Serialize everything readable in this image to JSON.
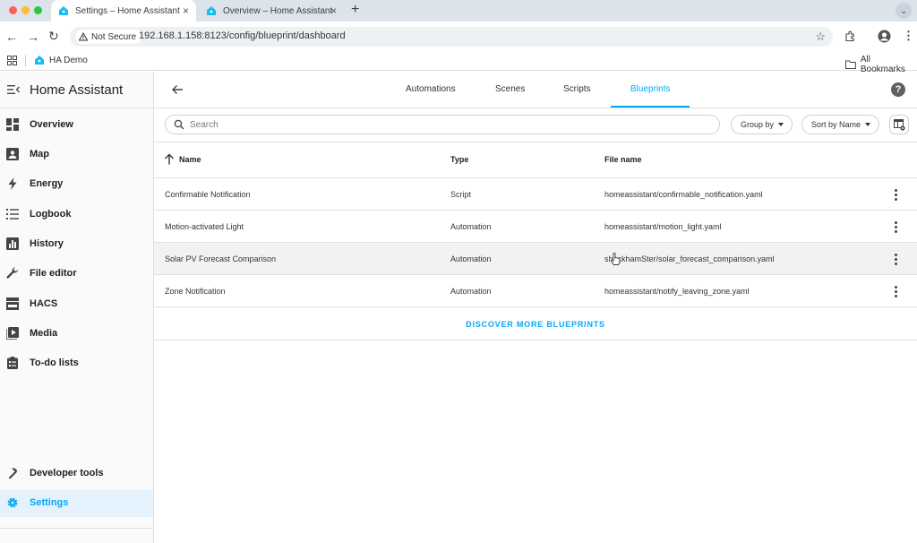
{
  "browser": {
    "tabs": [
      {
        "title": "Settings – Home Assistant",
        "active": true
      },
      {
        "title": "Overview – Home Assistant",
        "active": false
      }
    ],
    "new_tab": "+",
    "security_label": "Not Secure",
    "url": "192.168.1.158:8123/config/blueprint/dashboard",
    "bookmarks": {
      "item": "HA Demo",
      "all": "All Bookmarks"
    }
  },
  "sidebar": {
    "title": "Home Assistant",
    "items": [
      {
        "label": "Overview",
        "icon": "dashboard-icon"
      },
      {
        "label": "Map",
        "icon": "map-icon"
      },
      {
        "label": "Energy",
        "icon": "lightning-icon"
      },
      {
        "label": "Logbook",
        "icon": "list-icon"
      },
      {
        "label": "History",
        "icon": "chart-icon"
      },
      {
        "label": "File editor",
        "icon": "wrench-icon"
      },
      {
        "label": "HACS",
        "icon": "hacs-icon"
      },
      {
        "label": "Media",
        "icon": "media-icon"
      },
      {
        "label": "To-do lists",
        "icon": "clipboard-icon"
      }
    ],
    "bottom": [
      {
        "label": "Developer tools",
        "icon": "hammer-icon"
      },
      {
        "label": "Settings",
        "icon": "gear-icon",
        "selected": true
      }
    ]
  },
  "main": {
    "tabs": [
      {
        "label": "Automations"
      },
      {
        "label": "Scenes"
      },
      {
        "label": "Scripts"
      },
      {
        "label": "Blueprints",
        "active": true
      }
    ],
    "help": "?",
    "search": {
      "placeholder": "Search",
      "value": ""
    },
    "group_by": "Group by",
    "sort_by": "Sort by Name",
    "columns": {
      "name": "Name",
      "type": "Type",
      "file": "File name"
    },
    "rows": [
      {
        "name": "Confirmable Notification",
        "type": "Script",
        "file": "homeassistant/confirmable_notification.yaml"
      },
      {
        "name": "Motion-activated Light",
        "type": "Automation",
        "file": "homeassistant/motion_light.yaml"
      },
      {
        "name": "Solar PV Forecast Comparison",
        "type": "Automation",
        "file": "shockhamSter/solar_forecast_comparison.yaml"
      },
      {
        "name": "Zone Notification",
        "type": "Automation",
        "file": "homeassistant/notify_leaving_zone.yaml"
      }
    ],
    "discover": "DISCOVER MORE BLUEPRINTS"
  },
  "colors": {
    "accent": "#03a9f4",
    "selected_bg": "#e3f2fd",
    "ha_logo": "#18bcf2"
  }
}
